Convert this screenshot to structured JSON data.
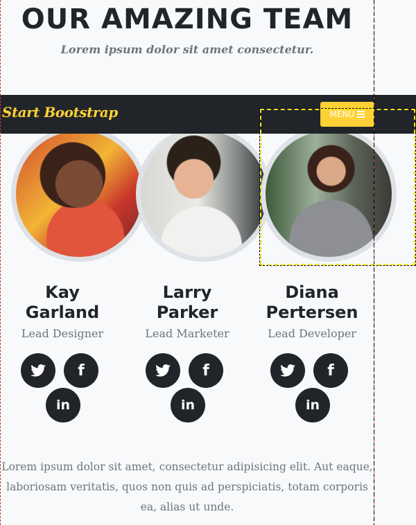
{
  "section": {
    "title": "OUR AMAZING TEAM",
    "subtitle": "Lorem ipsum dolor sit amet consectetur."
  },
  "navbar": {
    "brand": "Start Bootstrap",
    "menu_label": "MENU",
    "menu_icon": "hamburger-icon"
  },
  "team": [
    {
      "name": "Kay Garland",
      "role": "Lead Designer",
      "social": [
        "twitter-icon",
        "facebook-icon",
        "linkedin-icon"
      ]
    },
    {
      "name": "Larry Parker",
      "role": "Lead Marketer",
      "social": [
        "twitter-icon",
        "facebook-icon",
        "linkedin-icon"
      ]
    },
    {
      "name": "Diana Pertersen",
      "role": "Lead Developer",
      "social": [
        "twitter-icon",
        "facebook-icon",
        "linkedin-icon"
      ]
    }
  ],
  "social_glyphs": {
    "facebook": "f",
    "linkedin": "in"
  },
  "footer_text": "Lorem ipsum dolor sit amet, consectetur adipisicing elit. Aut eaque, laboriosam veritatis, quos non quis ad perspiciatis, totam corporis ea, alias ut unde.",
  "colors": {
    "brand": "#fed136",
    "dark": "#212529",
    "muted": "#6c757d"
  }
}
